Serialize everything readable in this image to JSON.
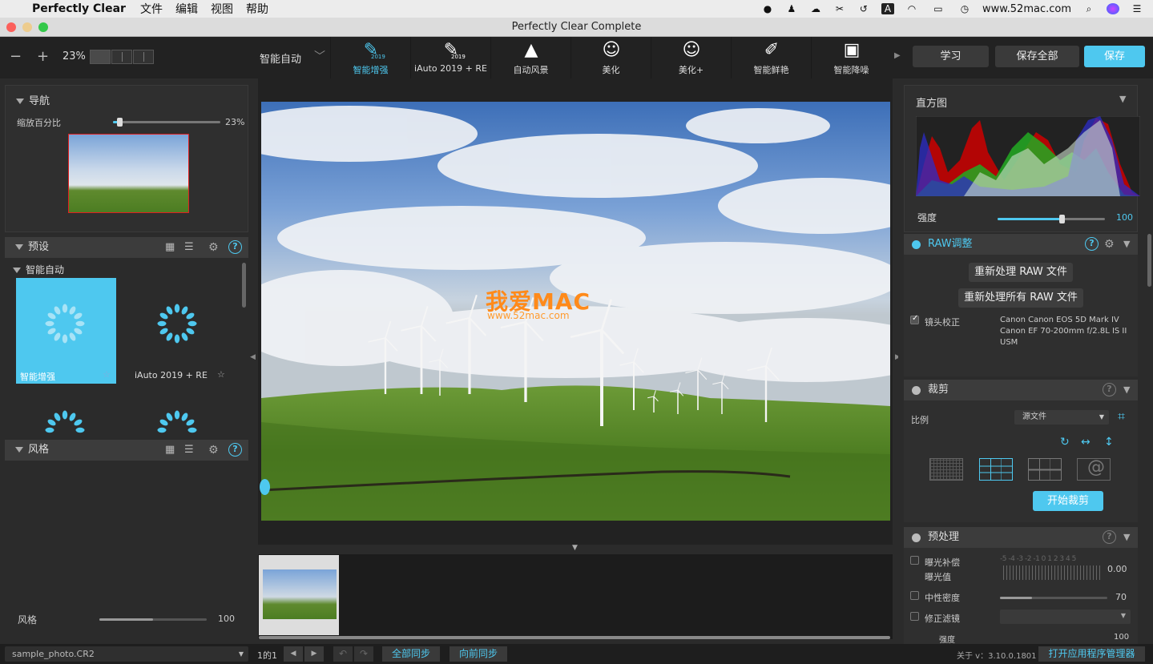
{
  "menubar": {
    "app": "Perfectly Clear",
    "items": [
      "文件",
      "编辑",
      "视图",
      "帮助"
    ],
    "url": "www.52mac.com"
  },
  "window": {
    "title": "Perfectly Clear Complete"
  },
  "toolbar": {
    "zoom": "23%",
    "preset_select": "智能自动",
    "tools": [
      {
        "label": "智能增强",
        "badge": "2019",
        "icon": "brush-icon",
        "active": true
      },
      {
        "label": "iAuto 2019 + RE",
        "badge": "2019",
        "icon": "brush-eye-icon",
        "active": false
      },
      {
        "label": "自动风景",
        "badge": "",
        "icon": "landscape-icon",
        "active": false
      },
      {
        "label": "美化",
        "badge": "",
        "icon": "face-icon",
        "active": false
      },
      {
        "label": "美化+",
        "badge": "",
        "icon": "face-plus-icon",
        "active": false
      },
      {
        "label": "智能鲜艳",
        "badge": "",
        "icon": "vivid-brush-icon",
        "active": false
      },
      {
        "label": "智能降噪",
        "badge": "",
        "icon": "noise-icon",
        "active": false
      }
    ],
    "learn": "学习",
    "save_all": "保存全部",
    "save": "保存"
  },
  "nav": {
    "title": "导航",
    "zoom_label": "缩放百分比",
    "zoom_value": "23%",
    "zoom_fraction": 0.06
  },
  "presets": {
    "title": "预设",
    "group": "智能自动",
    "items": [
      {
        "label": "智能增强",
        "selected": true
      },
      {
        "label": "iAuto 2019 + RE",
        "selected": false
      }
    ]
  },
  "style": {
    "title": "风格",
    "slider_label": "风格",
    "slider_value": "100",
    "slider_fraction": 0.5
  },
  "image": {
    "watermark_title": "我爱MAC",
    "watermark_url": "www.52mac.com"
  },
  "histogram": {
    "title": "直方图",
    "strength_label": "强度",
    "strength_value": "100",
    "strength_fraction": 0.6
  },
  "raw": {
    "title": "RAW调整",
    "reprocess": "重新处理 RAW 文件",
    "reprocess_all": "重新处理所有 RAW 文件",
    "lens_label": "镜头校正",
    "lens_info": [
      "Canon Canon EOS 5D Mark IV",
      "Canon EF 70-200mm f/2.8L IS II",
      "USM"
    ]
  },
  "crop": {
    "title": "裁剪",
    "ratio_label": "比例",
    "ratio_value": "源文件",
    "start": "开始裁剪"
  },
  "pre": {
    "title": "预处理",
    "exposure_label": "曝光补偿",
    "exposure_sub": "曝光值",
    "exposure_scale": "-5 -4 -3 -2 -1  0  1  2  3  4  5",
    "exposure_value": "0.00",
    "nd_label": "中性密度",
    "nd_value": "70",
    "nd_fraction": 0.3,
    "filter_label": "修正滤镜",
    "strength_label": "强度",
    "strength_value": "100"
  },
  "bottom": {
    "file": "sample_photo.CR2",
    "page": "1的1",
    "sync_all": "全部同步",
    "sync_fwd": "向前同步",
    "version": "关于 v：3.10.0.1801",
    "app_manager": "打开应用程序管理器"
  },
  "colors": {
    "accent": "#4ec8ef",
    "panel": "#2b2b2b",
    "header": "#3c3c3c"
  }
}
